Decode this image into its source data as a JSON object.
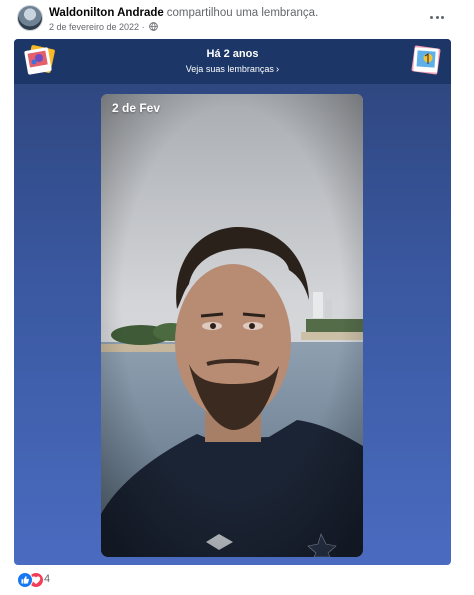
{
  "post": {
    "author": "Waldonilton Andrade",
    "action": "compartilhou uma lembrança.",
    "date": "2 de fevereiro de 2022",
    "separator": "·"
  },
  "memory": {
    "title": "Há 2 anos",
    "link": "Veja suas lembranças",
    "photo_date": "2 de Fev"
  },
  "reactions": {
    "count": "4",
    "types": [
      "like-icon",
      "love-icon"
    ]
  },
  "colors": {
    "banner": "#1c3767",
    "card_top": "#2d447a",
    "card_bottom": "#4a6bc0",
    "like": "#1877f2",
    "love": "#f33e58"
  }
}
